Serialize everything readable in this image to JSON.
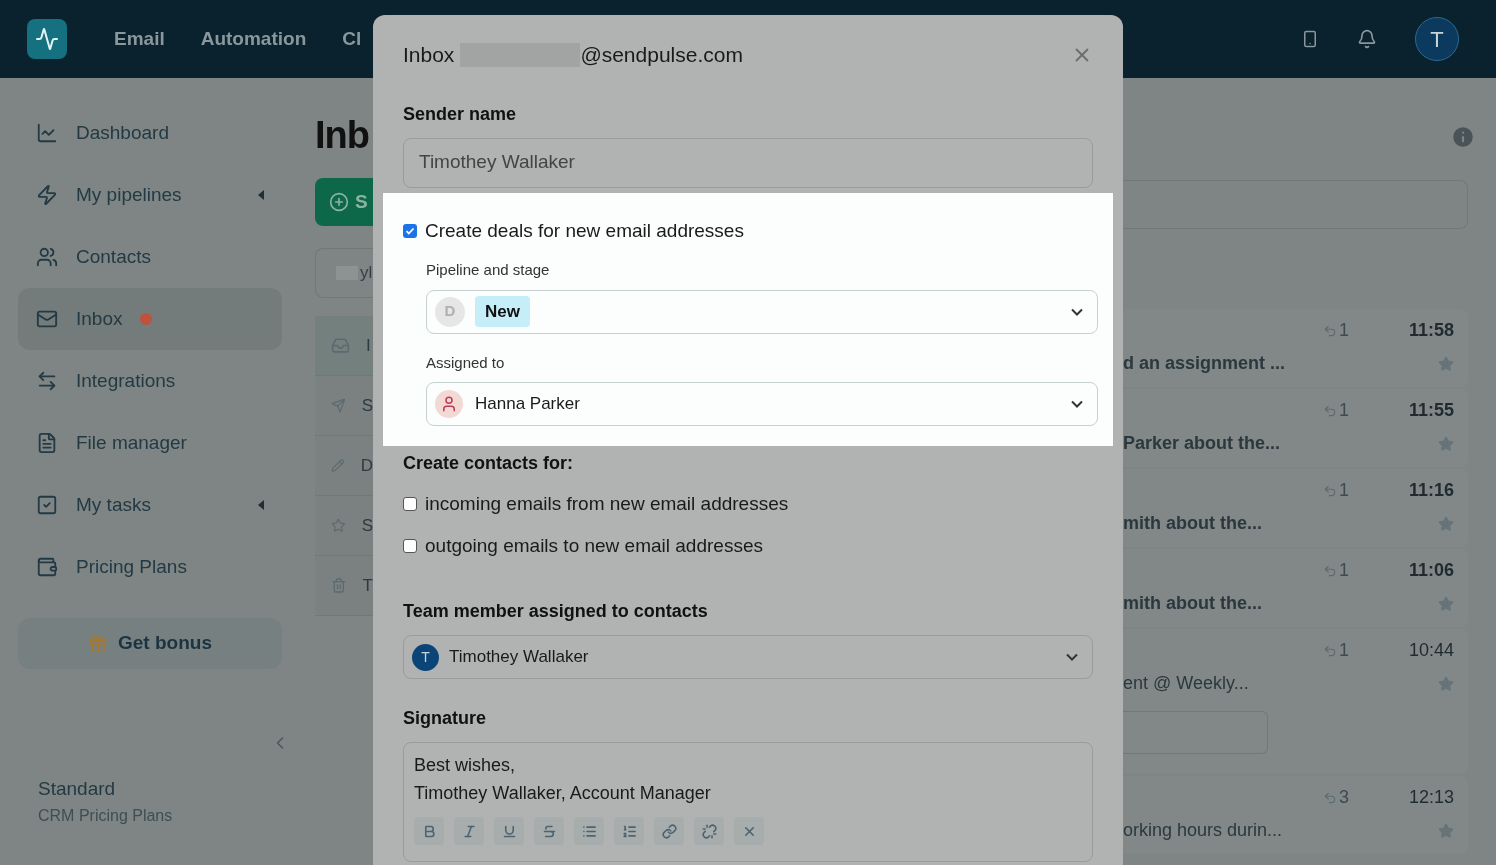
{
  "nav": {
    "items": [
      "Email",
      "Automation",
      "Cl"
    ],
    "avatar": "T"
  },
  "sidebar": {
    "items": [
      {
        "label": "Dashboard",
        "caret": false,
        "selected": false
      },
      {
        "label": "My pipelines",
        "caret": true,
        "selected": false
      },
      {
        "label": "Contacts",
        "caret": false,
        "selected": false
      },
      {
        "label": "Inbox",
        "caret": false,
        "selected": true,
        "color": "#c0523a"
      },
      {
        "label": "Integrations",
        "caret": false,
        "selected": false
      },
      {
        "label": "File manager",
        "caret": false,
        "selected": false
      },
      {
        "label": "My tasks",
        "caret": true,
        "selected": false
      },
      {
        "label": "Pricing Plans",
        "caret": false,
        "selected": false
      }
    ],
    "bonus": "Get bonus",
    "plan": "Standard",
    "plan_subtitle": "CRM Pricing Plans"
  },
  "background": {
    "page_title": "Inb",
    "button": "S",
    "search": "yl",
    "folders": [
      "I",
      "S",
      "D",
      "S",
      "T"
    ]
  },
  "messages": [
    {
      "replies": "1",
      "time": "11:58",
      "snippet": "d an assignment ...",
      "unread": true,
      "reply_box": false
    },
    {
      "replies": "1",
      "time": "11:55",
      "snippet": "Parker about the...",
      "unread": true,
      "reply_box": false
    },
    {
      "replies": "1",
      "time": "11:16",
      "snippet": "mith about the...",
      "unread": true,
      "reply_box": false
    },
    {
      "replies": "1",
      "time": "11:06",
      "snippet": "mith about the...",
      "unread": true,
      "reply_box": false
    },
    {
      "replies": "1",
      "time": "10:44",
      "snippet": "ent @ Weekly...",
      "unread": false,
      "reply_box": true
    },
    {
      "replies": "3",
      "time": "12:13",
      "snippet": "orking hours durin...",
      "unread": false,
      "reply_box": false
    }
  ],
  "modal": {
    "title_prefix": "Inbox",
    "title_suffix": "@sendpulse.com",
    "sender_label": "Sender name",
    "sender_value": "Timothey Wallaker",
    "deals": {
      "checked": true,
      "label": "Create deals for new email addresses",
      "pipeline_label": "Pipeline and stage",
      "pipeline_letter": "D",
      "stage": "New",
      "assigned_label": "Assigned to",
      "assigned_value": "Hanna Parker"
    },
    "contacts_heading": "Create contacts for:",
    "contact_options": [
      {
        "label": "incoming emails from new email addresses",
        "checked": false
      },
      {
        "label": "outgoing emails to new email addresses",
        "checked": false
      }
    ],
    "team_label": "Team member assigned to contacts",
    "team_avatar": "T",
    "team_value": "Timothey Wallaker",
    "signature_label": "Signature",
    "signature_lines": [
      "Best wishes,",
      "Timothey Wallaker, Account Manager"
    ]
  }
}
